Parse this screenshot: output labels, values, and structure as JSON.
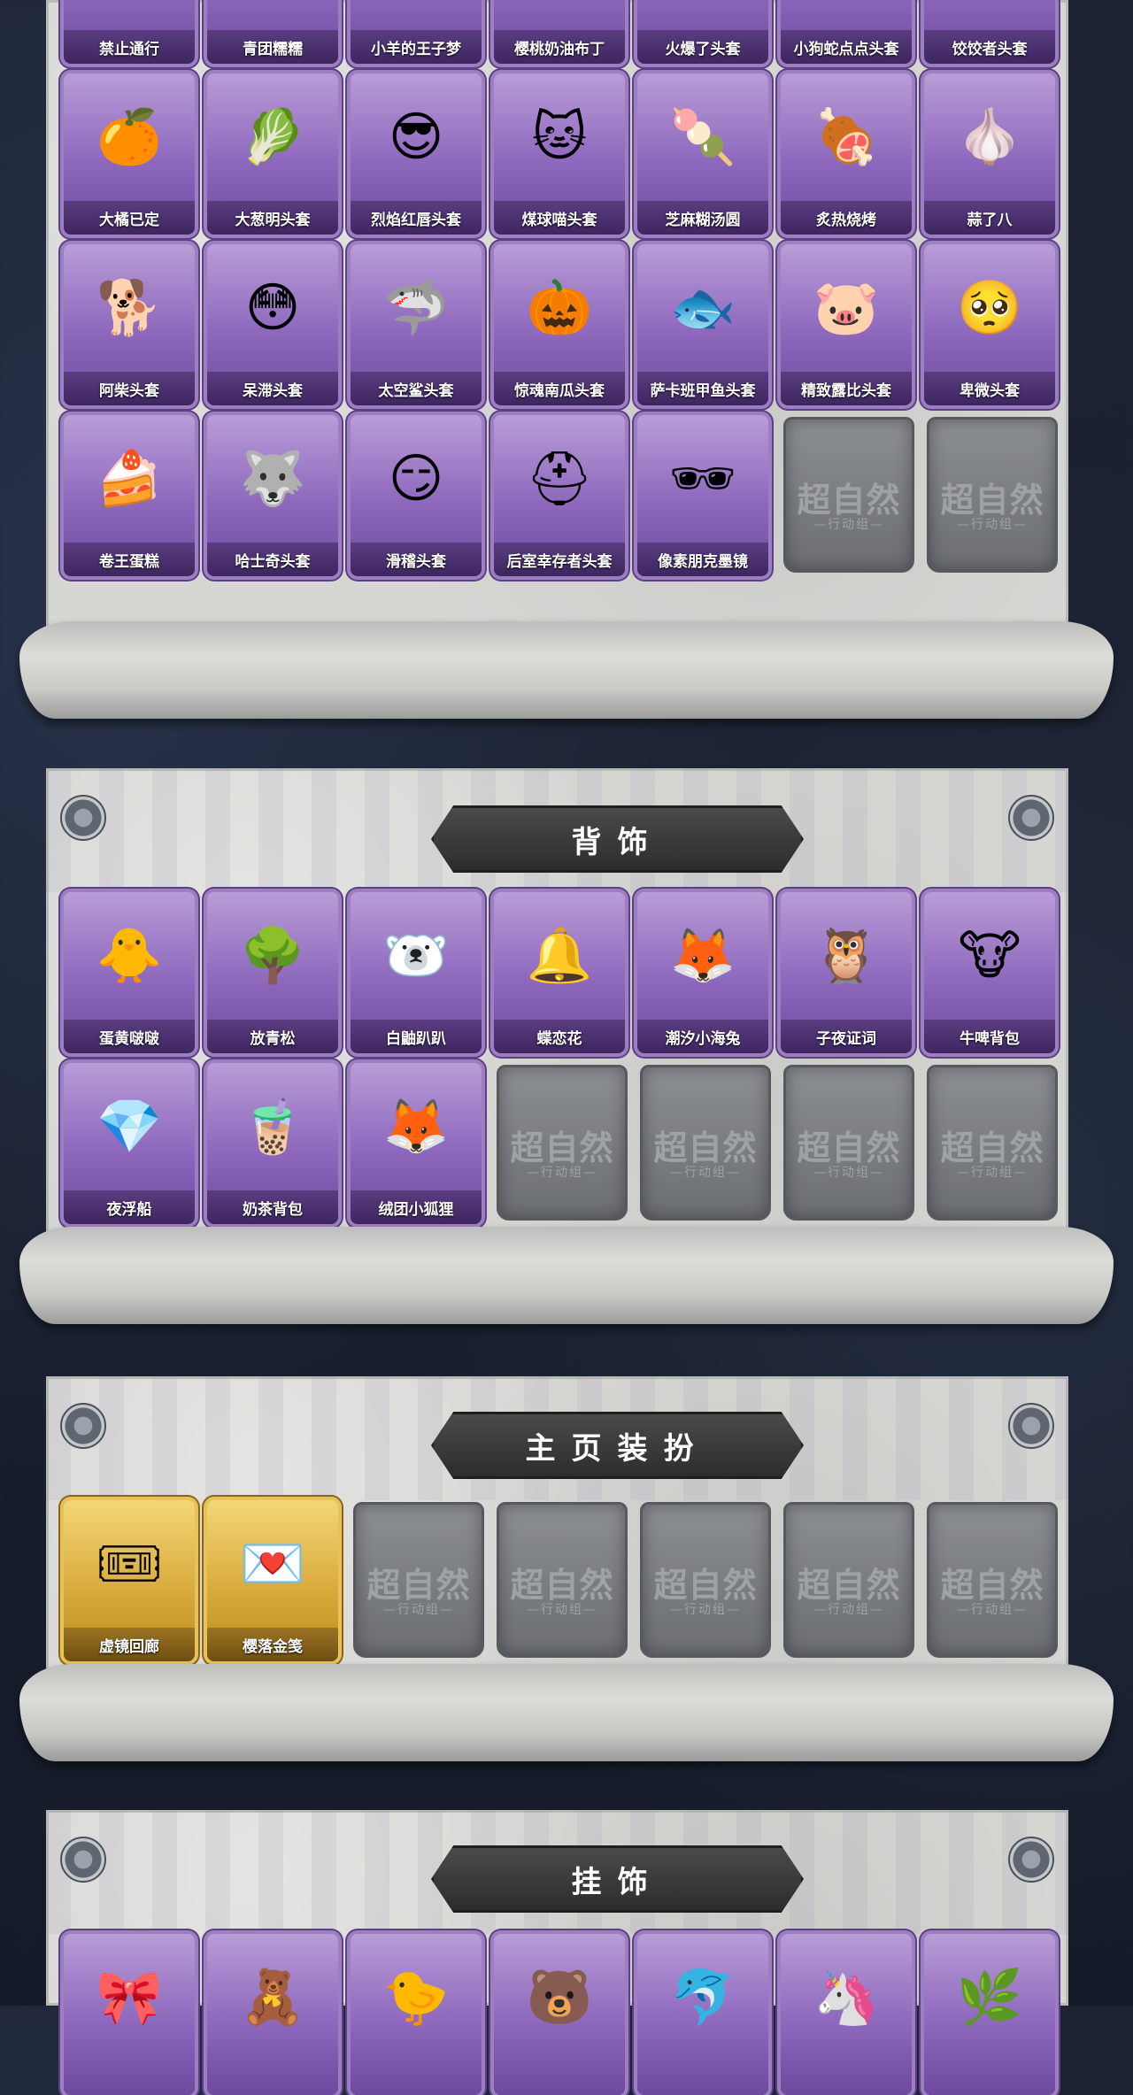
{
  "sections": {
    "headwear": {
      "items": [
        {
          "label": "禁止通行",
          "icon": "traffic-cone",
          "emoji": "🚧"
        },
        {
          "label": "青团糯糯",
          "icon": "green-dumpling",
          "emoji": "🟢"
        },
        {
          "label": "小羊的王子梦",
          "icon": "sheep",
          "emoji": "🐑"
        },
        {
          "label": "樱桃奶油布丁",
          "icon": "pudding",
          "emoji": "🍮"
        },
        {
          "label": "火爆了头套",
          "icon": "fire",
          "emoji": "🔥"
        },
        {
          "label": "小狗蛇点点头套",
          "icon": "snake",
          "emoji": "🐍"
        },
        {
          "label": "饺饺者头套",
          "icon": "dumpling",
          "emoji": "🥟"
        },
        {
          "label": "大橘已定",
          "icon": "orange",
          "emoji": "🍊"
        },
        {
          "label": "大葱明头套",
          "icon": "scallion",
          "emoji": "🥬"
        },
        {
          "label": "烈焰红唇头套",
          "icon": "pikachu-hood",
          "emoji": "😎"
        },
        {
          "label": "煤球喵头套",
          "icon": "cat",
          "emoji": "🐱"
        },
        {
          "label": "芝麻糊汤圆",
          "icon": "rice-ball",
          "emoji": "🍡"
        },
        {
          "label": "炙热烧烤",
          "icon": "meat",
          "emoji": "🍖"
        },
        {
          "label": "蒜了八",
          "icon": "garlic",
          "emoji": "🧄"
        },
        {
          "label": "阿柴头套",
          "icon": "shiba",
          "emoji": "🐕"
        },
        {
          "label": "呆滞头套",
          "icon": "blank-face",
          "emoji": "😳"
        },
        {
          "label": "太空鲨头套",
          "icon": "shark",
          "emoji": "🦈"
        },
        {
          "label": "惊魂南瓜头套",
          "icon": "pumpkin",
          "emoji": "🎃"
        },
        {
          "label": "萨卡班甲鱼头套",
          "icon": "fish",
          "emoji": "🐟"
        },
        {
          "label": "精致露比头套",
          "icon": "pink-beaver",
          "emoji": "🐷"
        },
        {
          "label": "卑微头套",
          "icon": "sad-face",
          "emoji": "🥺"
        },
        {
          "label": "卷王蛋糕",
          "icon": "cake-roll",
          "emoji": "🍰"
        },
        {
          "label": "哈士奇头套",
          "icon": "husky",
          "emoji": "🐺"
        },
        {
          "label": "滑稽头套",
          "icon": "smirk-face",
          "emoji": "😏"
        },
        {
          "label": "后室幸存者头套",
          "icon": "gas-mask",
          "emoji": "⛑"
        },
        {
          "label": "像素朋克墨镜",
          "icon": "pixel-sunglasses",
          "emoji": "🕶"
        }
      ],
      "empty_slots": 2
    },
    "back_accessories": {
      "title": "背饰",
      "items": [
        {
          "label": "蛋黄啵啵",
          "icon": "chick",
          "emoji": "🐥"
        },
        {
          "label": "放青松",
          "icon": "bonsai",
          "emoji": "🌳"
        },
        {
          "label": "白鼬趴趴",
          "icon": "ermine",
          "emoji": "🐻‍❄️"
        },
        {
          "label": "蝶恋花",
          "icon": "bell-ornament",
          "emoji": "🔔"
        },
        {
          "label": "潮汐小海兔",
          "icon": "sea-bunny",
          "emoji": "🦊"
        },
        {
          "label": "子夜证词",
          "icon": "owl",
          "emoji": "🦉"
        },
        {
          "label": "牛啤背包",
          "icon": "cow-barrel",
          "emoji": "🐮"
        },
        {
          "label": "夜浮船",
          "icon": "crystal-ship",
          "emoji": "💎"
        },
        {
          "label": "奶茶背包",
          "icon": "milk-tea",
          "emoji": "🧋"
        },
        {
          "label": "绒团小狐狸",
          "icon": "fox",
          "emoji": "🦊"
        }
      ],
      "empty_slots": 4
    },
    "homepage_decor": {
      "title": "主页装扮",
      "items": [
        {
          "label": "虚镜回廊",
          "icon": "purple-card",
          "emoji": "🎟"
        },
        {
          "label": "樱落金笺",
          "icon": "pink-card",
          "emoji": "💌"
        }
      ],
      "empty_slots": 5
    },
    "pendants": {
      "title": "挂饰",
      "items": [
        {
          "label": "",
          "icon": "pendant-1",
          "emoji": "🎀"
        },
        {
          "label": "",
          "icon": "pendant-2",
          "emoji": "🧸"
        },
        {
          "label": "",
          "icon": "pendant-3",
          "emoji": "🐤"
        },
        {
          "label": "",
          "icon": "pendant-4",
          "emoji": "🐻"
        },
        {
          "label": "",
          "icon": "pendant-5",
          "emoji": "🐬"
        },
        {
          "label": "",
          "icon": "pendant-6",
          "emoji": "🦄"
        },
        {
          "label": "",
          "icon": "pendant-7",
          "emoji": "🌿"
        }
      ]
    }
  },
  "placeholder": {
    "watermark": "超自然",
    "subtitle": "—行动组—"
  },
  "colors": {
    "item_purple": "#8d68bd",
    "item_gold": "#d9ab3c",
    "banner": "#2d2d2d",
    "panel": "#d6d6d3"
  }
}
